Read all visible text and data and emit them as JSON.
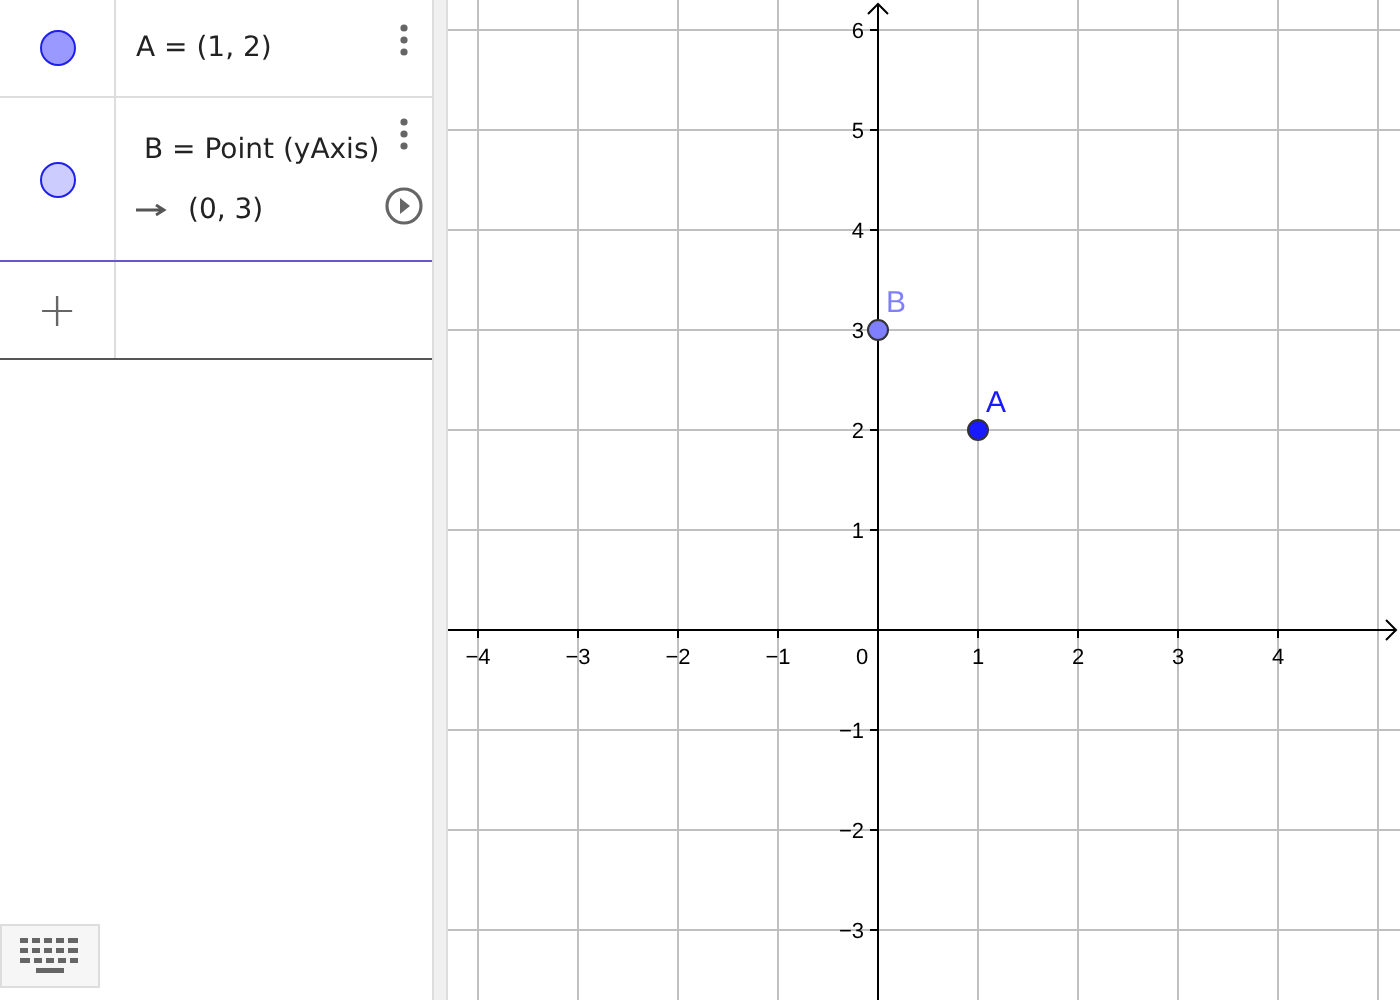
{
  "algebra": {
    "items": [
      {
        "kind": "value",
        "color": "#9999ff",
        "text": "A = (1, 2)"
      },
      {
        "kind": "dependent",
        "color": "#ccccff",
        "text": "B = Point (yAxis)",
        "value": "(0, 3)"
      }
    ],
    "input_icon": "+"
  },
  "graphics": {
    "origin_label": "0",
    "chart_data": {
      "type": "scatter",
      "grid": true,
      "xlim": [
        -4.3,
        5.22
      ],
      "ylim": [
        -3.7,
        6.3
      ],
      "xticks": [
        {
          "value": -4,
          "label": "−4"
        },
        {
          "value": -3,
          "label": "−3"
        },
        {
          "value": -2,
          "label": "−2"
        },
        {
          "value": -1,
          "label": "−1"
        },
        {
          "value": 1,
          "label": "1"
        },
        {
          "value": 2,
          "label": "2"
        },
        {
          "value": 3,
          "label": "3"
        },
        {
          "value": 4,
          "label": "4"
        }
      ],
      "yticks": [
        {
          "value": -3,
          "label": "−3"
        },
        {
          "value": -2,
          "label": "−2"
        },
        {
          "value": -1,
          "label": "−1"
        },
        {
          "value": 1,
          "label": "1"
        },
        {
          "value": 2,
          "label": "2"
        },
        {
          "value": 3,
          "label": "3"
        },
        {
          "value": 4,
          "label": "4"
        },
        {
          "value": 5,
          "label": "5"
        },
        {
          "value": 6,
          "label": "6"
        }
      ],
      "series": [
        {
          "name": "A",
          "color": "#1a1aff",
          "x": [
            1
          ],
          "values": [
            2
          ]
        },
        {
          "name": "B",
          "color": "#8080ff",
          "x": [
            0
          ],
          "values": [
            3
          ]
        }
      ]
    }
  }
}
